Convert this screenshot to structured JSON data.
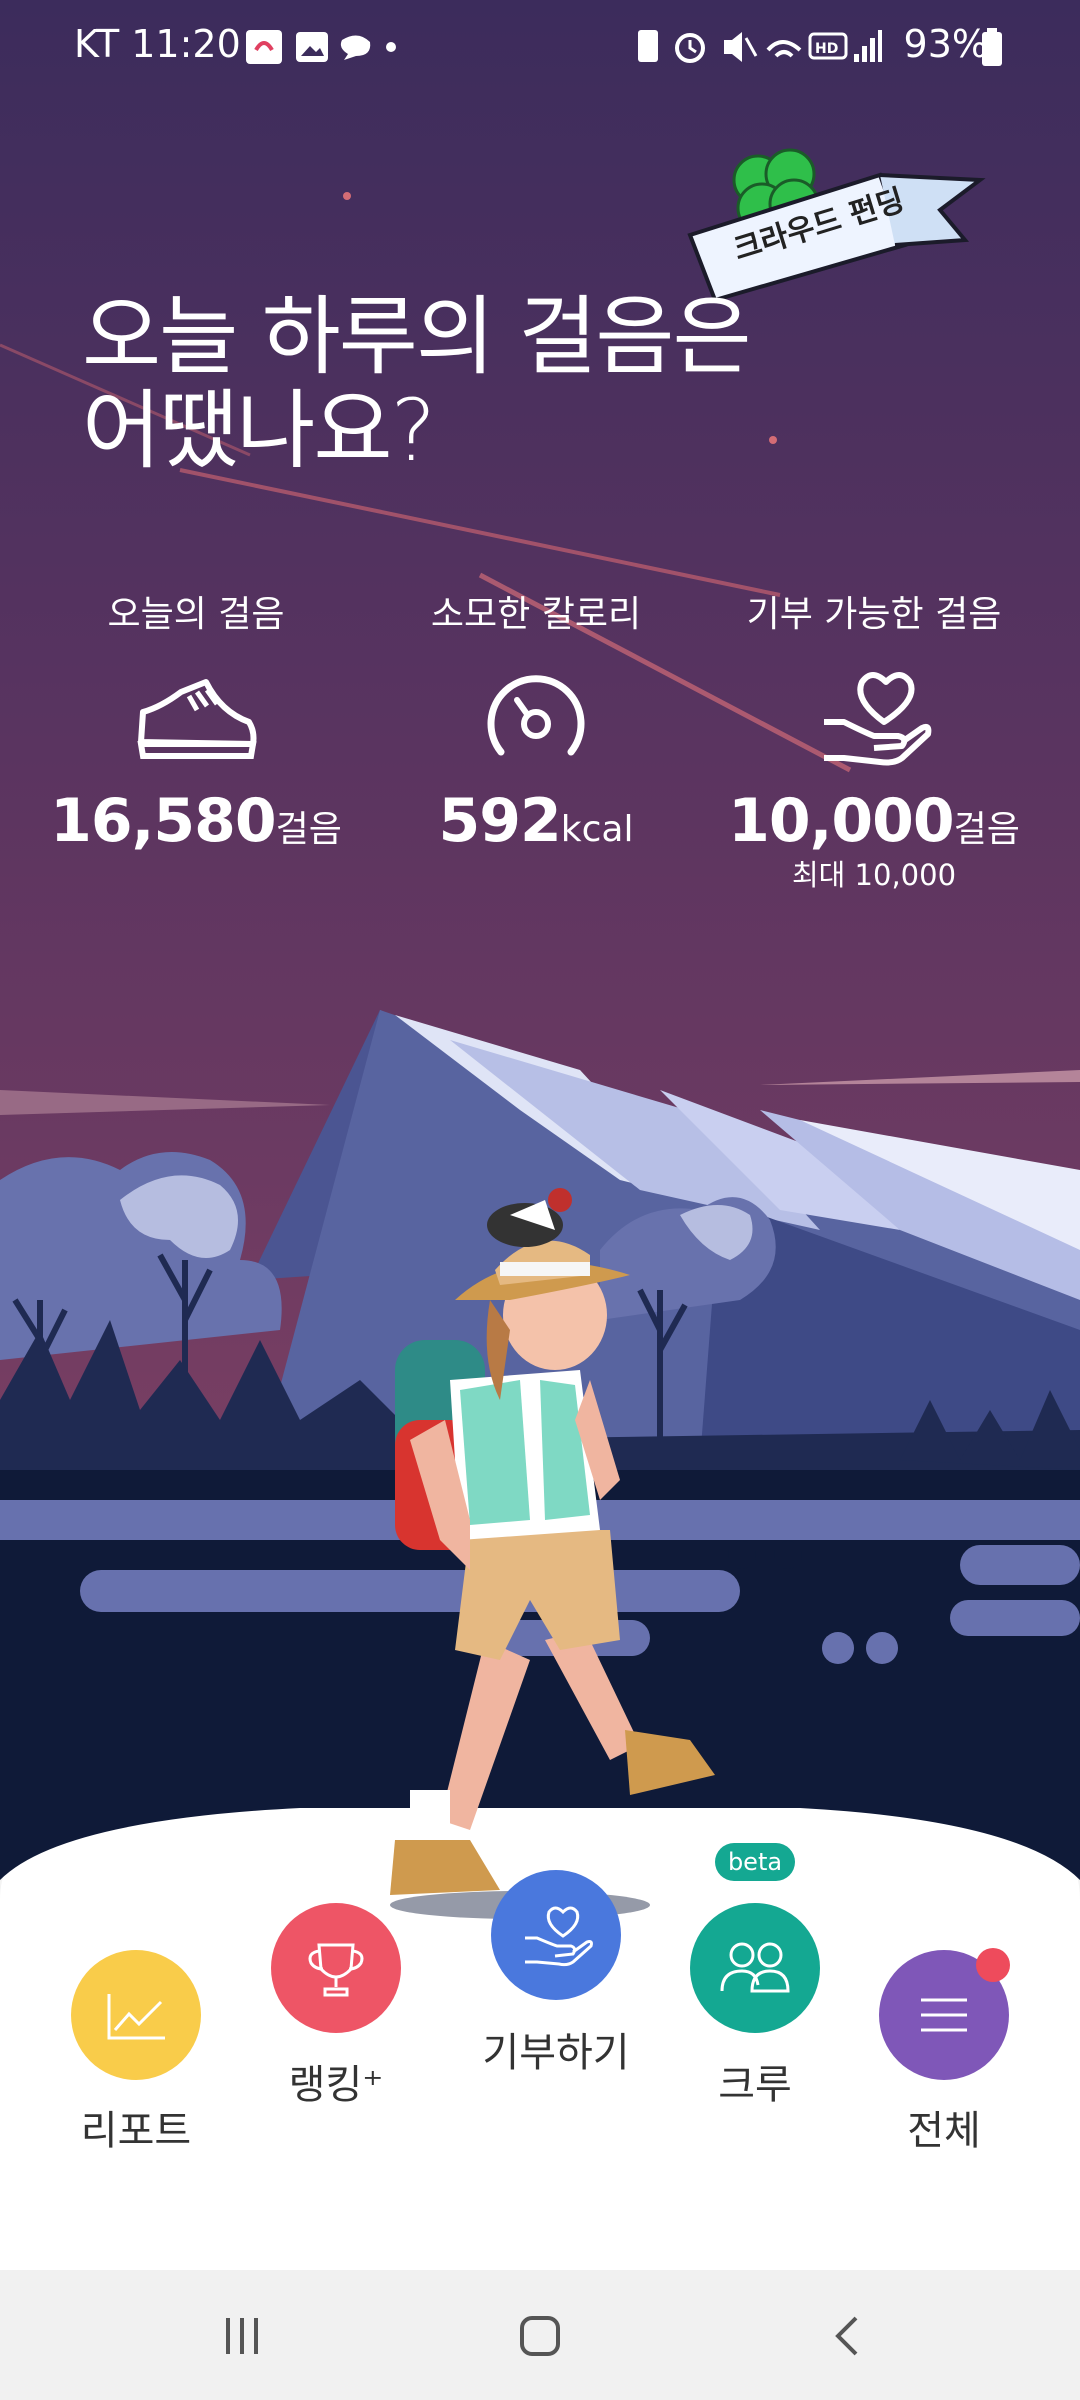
{
  "status_bar": {
    "carrier_time": "KT 11:20",
    "battery": "93%"
  },
  "banner": {
    "label": "크라우드 펀딩"
  },
  "headline": {
    "line1": "오늘 하루의 걸음은",
    "line2": "어땠나요?"
  },
  "stats": {
    "steps": {
      "label": "오늘의 걸음",
      "value": "16,580",
      "unit": "걸음"
    },
    "calories": {
      "label": "소모한 칼로리",
      "value": "592",
      "unit": "kcal"
    },
    "donatable": {
      "label": "기부 가능한 걸음",
      "value": "10,000",
      "unit": "걸음",
      "max": "최대 10,000"
    }
  },
  "nav": {
    "report": {
      "label": "리포트",
      "color": "#f9cc4a"
    },
    "ranking": {
      "label": "랭킹⁺",
      "color": "#ee5566"
    },
    "donate": {
      "label": "기부하기",
      "color": "#4a78dd"
    },
    "crew": {
      "label": "크루",
      "badge": "beta",
      "color": "#14a892"
    },
    "all": {
      "label": "전체",
      "color": "#7f57b8"
    }
  },
  "icons": [
    "shoe-icon",
    "gauge-icon",
    "heart-hand-icon",
    "chart-icon",
    "trophy-icon",
    "people-icon",
    "menu-icon"
  ]
}
